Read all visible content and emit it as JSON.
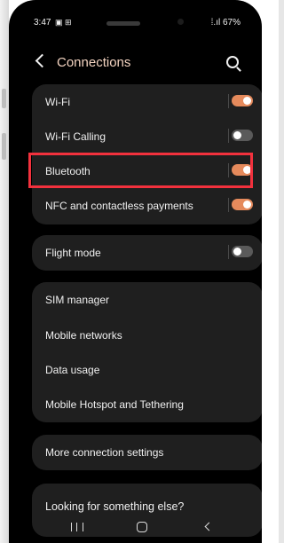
{
  "status_bar": {
    "time": "3:47",
    "left_icons": "▣ ⊞",
    "right_text": "67%",
    "signal": "⁞.ıl"
  },
  "header": {
    "title": "Connections"
  },
  "groups": {
    "main": [
      {
        "label": "Wi-Fi",
        "toggle": "on"
      },
      {
        "label": "Wi-Fi Calling",
        "toggle": "off"
      },
      {
        "label": "Bluetooth",
        "toggle": "on"
      },
      {
        "label": "NFC and contactless payments",
        "toggle": "on"
      }
    ],
    "flight": {
      "label": "Flight mode",
      "toggle": "off"
    },
    "network": [
      {
        "label": "SIM manager"
      },
      {
        "label": "Mobile networks"
      },
      {
        "label": "Data usage"
      },
      {
        "label": "Mobile Hotspot and Tethering"
      }
    ],
    "more": {
      "label": "More connection settings"
    },
    "looking": {
      "label": "Looking for something else?"
    }
  },
  "colors": {
    "accent": "#e58a5c",
    "title": "#f3d3c0",
    "highlight": "#f2313d",
    "card": "#1f1f1f"
  },
  "icons": {
    "back": "back-arrow-icon",
    "search": "search-icon",
    "nav_recents": "recents-icon",
    "nav_home": "home-icon",
    "nav_back": "back-icon"
  }
}
